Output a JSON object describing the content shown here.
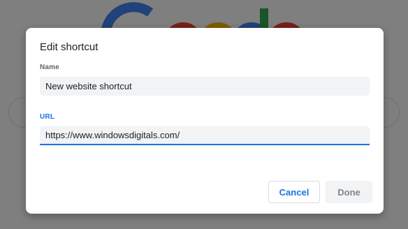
{
  "background": {
    "logo_colors": [
      "#4285f4",
      "#ea4335",
      "#fbbc05",
      "#4285f4",
      "#34a853",
      "#ea4335"
    ]
  },
  "dialog": {
    "title": "Edit shortcut",
    "name_label": "Name",
    "name_value": "New website shortcut",
    "url_label": "URL",
    "url_value": "https://www.windowsdigitals.com/",
    "cancel_label": "Cancel",
    "done_label": "Done",
    "accent_color": "#1a73e8"
  }
}
